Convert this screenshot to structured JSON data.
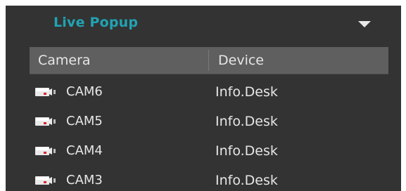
{
  "panel": {
    "title": "Live Popup",
    "title_color": "#21a3b3",
    "background_color": "#333333",
    "toggle_icon": "chevron-down-icon"
  },
  "table": {
    "headers": {
      "camera": "Camera",
      "device": "Device"
    },
    "header_background": "#5f5f5f",
    "row_icon": "camera-icon",
    "rows": [
      {
        "camera": "CAM6",
        "device": "Info.Desk"
      },
      {
        "camera": "CAM5",
        "device": "Info.Desk"
      },
      {
        "camera": "CAM4",
        "device": "Info.Desk"
      },
      {
        "camera": "CAM3",
        "device": "Info.Desk"
      }
    ]
  }
}
